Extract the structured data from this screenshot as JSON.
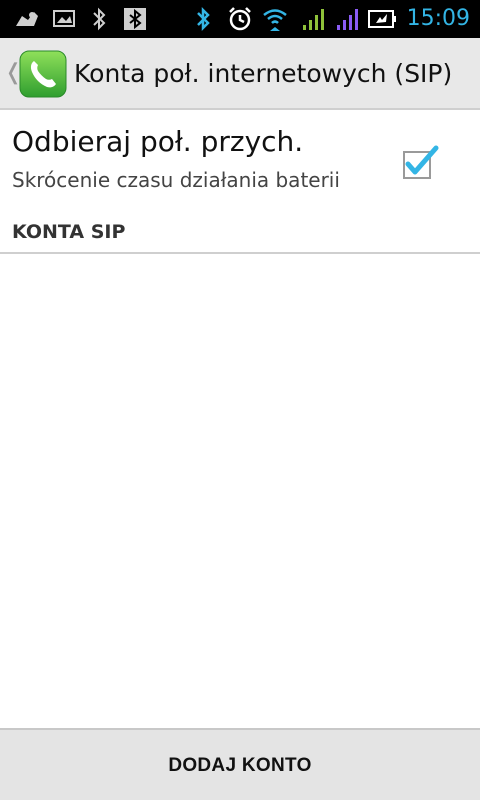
{
  "status_bar": {
    "time": "15:09",
    "icons": [
      "debug-icon",
      "image-icon",
      "bluetooth-icon",
      "bluetooth-box-icon",
      "bluetooth-active-icon",
      "alarm-icon",
      "wifi-icon",
      "signal-green-icon",
      "signal-purple-icon",
      "battery-icon"
    ],
    "accent_color": "#33b5e5"
  },
  "action_bar": {
    "title": "Konta poł. internetowych (SIP)",
    "icon": "phone-icon"
  },
  "preference": {
    "title": "Odbieraj poł. przych.",
    "summary": "Skrócenie czasu działania baterii",
    "checked": true
  },
  "section": {
    "header": "KONTA SIP"
  },
  "bottom_bar": {
    "button_label": "DODAJ KONTO"
  }
}
